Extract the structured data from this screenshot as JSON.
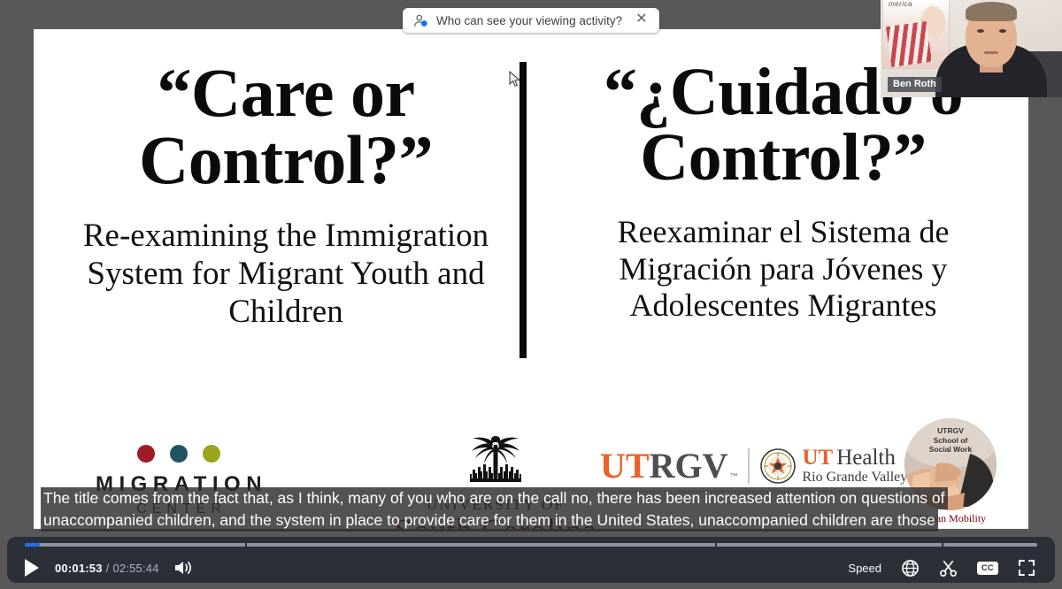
{
  "window": {
    "background_color": "#585858"
  },
  "activity_pill": {
    "icon": "person-add-icon",
    "text": "Who can see your viewing activity?",
    "close_icon": "close-icon"
  },
  "webcam": {
    "participant_name": "Ben Roth"
  },
  "slide": {
    "left": {
      "title": "“Care or Control?”",
      "subtitle": "Re-examining the Immigration System for Migrant Youth and Children"
    },
    "right": {
      "title": "“¿Cuidado o Control?”",
      "subtitle": "Reexaminar el Sistema de Migración para Jóvenes y Adolescentes Migrantes"
    },
    "logos": [
      {
        "name": "migration-center",
        "line1": "MIGRATION",
        "line2": "CENTER",
        "dot_colors": [
          "#9e1b28",
          "#1f5560",
          "#9aa41c"
        ]
      },
      {
        "name": "university-of-south-carolina",
        "line1": "UNIVERSITY OF",
        "line2": "South Carolina",
        "emblem": "palmetto-tree-icon",
        "color": "#73000a"
      },
      {
        "name": "utrgv-ut-health",
        "part1": "UT",
        "part2": "RGV",
        "trademark": "™",
        "health1": "UT",
        "health2": "Health",
        "health3": "Rio Grande Valley",
        "orange": "#e8622c",
        "gray": "#4e4e52"
      },
      {
        "name": "utrgv-school-of-social-work",
        "line1": "UTRGV",
        "line2": "School of",
        "line3": "Social Work",
        "caption": "Human Mobility"
      }
    ]
  },
  "captions": {
    "line1": "The title comes from the fact that, as I think, many of you who are on the call no, there has been increased attention on questions of",
    "line2": "unaccompanied children, and the system in place to provide care for them in the United States, unaccompanied children are those"
  },
  "player": {
    "play_icon": "play-icon",
    "current_time": "00:01:53",
    "separator": "/",
    "duration": "02:55:44",
    "volume_icon": "volume-icon",
    "speed_label": "Speed",
    "language_icon": "globe-translate-icon",
    "clip_icon": "scissors-icon",
    "cc_label": "CC",
    "fullscreen_icon": "fullscreen-icon",
    "progress_percent": 1.5,
    "progress_fill_color": "#1a73e8",
    "track_color": "#8d95a3",
    "bar_color": "#2b2f38"
  }
}
